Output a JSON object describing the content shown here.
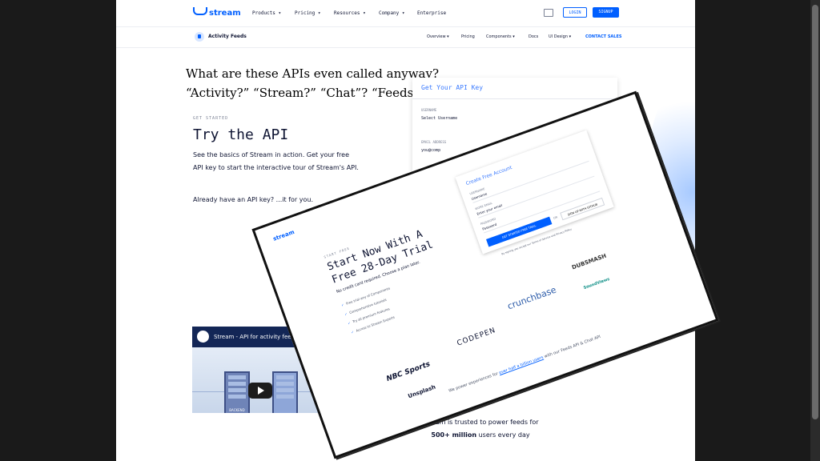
{
  "nav": {
    "logo": "stream",
    "items": [
      "Products ▾",
      "Pricing ▾",
      "Resources ▾",
      "Company ▾",
      "Enterprise"
    ],
    "login": "LOGIN",
    "signup": "SIGNUP"
  },
  "subnav": {
    "title": "Activity Feeds",
    "items": [
      "Overview ▾",
      "Pricing",
      "Components ▾",
      "Docs",
      "UI Design ▾"
    ],
    "contact": "CONTACT SALES"
  },
  "handwritten": {
    "line1": "What are these APIs even called anyway?",
    "line2": "“Activity?” “Stream?” “Chat”? “Feeds”?"
  },
  "hero": {
    "eyebrow": "GET STARTED",
    "title": "Try the API",
    "para1": "See the basics of Stream in action. Get your free API key to start the interactive tour of Stream's API.",
    "para2": "Already have an API key? ...it for you."
  },
  "api_card": {
    "title": "Get Your API Key",
    "username_label": "USERNAME",
    "username_value": "Select Username",
    "email_label": "EMAIL ADDRESS",
    "email_value": "you@comp"
  },
  "video": {
    "title": "Stream - API for activity feeds a...",
    "rack_label": "BACKEND"
  },
  "trusted": {
    "line1": "Stream is trusted to power feeds for",
    "line2_bold": "500+ million",
    "line2_rest": " users every day"
  },
  "overlay": {
    "logo": "stream",
    "eyebrow": "START FREE",
    "title": "Start Now With A Free 28-Day Trial",
    "subtitle": "No credit card required. Choose a plan later.",
    "checks": [
      "Free trial any of Components",
      "Comprehensive tutorials",
      "Try all premium features",
      "Access to Stream Experts"
    ],
    "form_title": "Create Free Account",
    "fields": [
      {
        "label": "USERNAME",
        "value": "Username"
      },
      {
        "label": "WORK EMAIL",
        "value": "Enter your email"
      },
      {
        "label": "PASSWORD",
        "value": "Password"
      }
    ],
    "button": "GET STARTED FREE TRIAL",
    "or": "OR",
    "github": "SIGN UP WITH GITHUB",
    "terms": "By signing you accept our Terms of Service and Privacy Policy",
    "brands": [
      "NBC Sports",
      "CODEPEN",
      "crunchbase",
      "DUBSMASH",
      "Unsplash",
      "SoundViews"
    ],
    "footer_pre": "We power experiences for ",
    "footer_link": "over half a billion users",
    "footer_post": " with our Feeds API & Chat API"
  }
}
